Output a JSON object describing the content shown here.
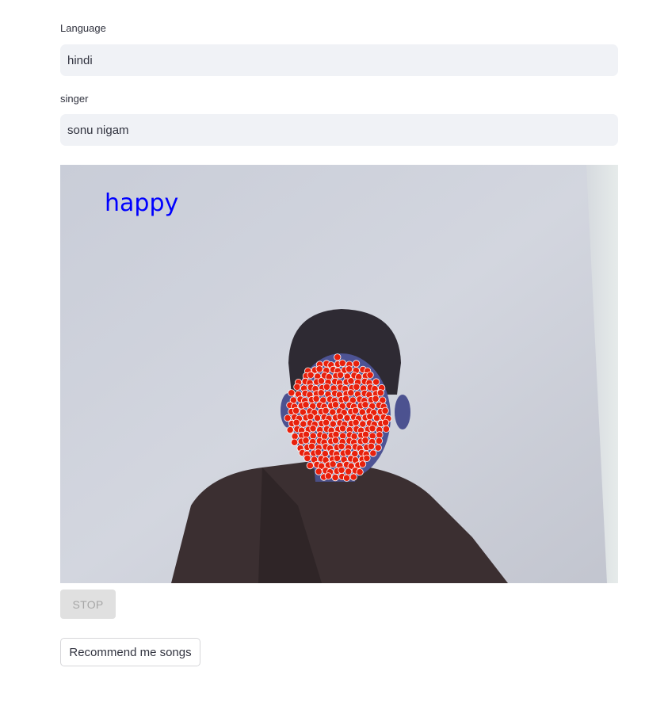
{
  "form": {
    "language_label": "Language",
    "language_value": "hindi",
    "singer_label": "singer",
    "singer_value": "sonu nigam"
  },
  "webcam": {
    "emotion_label": "happy",
    "emotion_label_color": "#0000ff",
    "landmark_color": "#e8200c",
    "stop_label": "STOP"
  },
  "actions": {
    "recommend_label": "Recommend me songs"
  }
}
